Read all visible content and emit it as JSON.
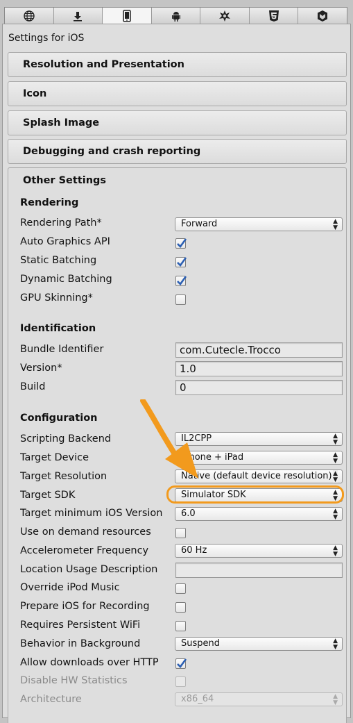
{
  "platform_tabs": [
    {
      "icon": "globe-icon",
      "active": false
    },
    {
      "icon": "download-icon",
      "active": false
    },
    {
      "icon": "mobile-device-icon",
      "active": true
    },
    {
      "icon": "android-icon",
      "active": false
    },
    {
      "icon": "blackberry-icon",
      "active": false
    },
    {
      "icon": "html5-icon",
      "active": false
    },
    {
      "icon": "tizen-icon",
      "active": false
    }
  ],
  "header": {
    "title": "Settings for iOS"
  },
  "sections": {
    "resolution": "Resolution and Presentation",
    "icon": "Icon",
    "splash": "Splash Image",
    "debugging": "Debugging and crash reporting",
    "other": "Other Settings"
  },
  "rendering": {
    "heading": "Rendering",
    "rendering_path": {
      "label": "Rendering Path*",
      "value": "Forward"
    },
    "auto_graphics_api": {
      "label": "Auto Graphics API",
      "checked": true
    },
    "static_batching": {
      "label": "Static Batching",
      "checked": true
    },
    "dynamic_batching": {
      "label": "Dynamic Batching",
      "checked": true
    },
    "gpu_skinning": {
      "label": "GPU Skinning*",
      "checked": false
    }
  },
  "identification": {
    "heading": "Identification",
    "bundle_identifier": {
      "label": "Bundle Identifier",
      "value": "com.Cutecle.Trocco"
    },
    "version": {
      "label": "Version*",
      "value": "1.0"
    },
    "build": {
      "label": "Build",
      "value": "0"
    }
  },
  "configuration": {
    "heading": "Configuration",
    "scripting_backend": {
      "label": "Scripting Backend",
      "value": "IL2CPP"
    },
    "target_device": {
      "label": "Target Device",
      "value": "iPhone + iPad"
    },
    "target_resolution": {
      "label": "Target Resolution",
      "value": "Native (default device resolution)"
    },
    "target_sdk": {
      "label": "Target SDK",
      "value": "Simulator SDK"
    },
    "target_min_ios": {
      "label": "Target minimum iOS Version",
      "value": "6.0"
    },
    "on_demand_resources": {
      "label": "Use on demand resources",
      "checked": false
    },
    "accelerometer_frequency": {
      "label": "Accelerometer Frequency",
      "value": "60 Hz"
    },
    "location_usage": {
      "label": "Location Usage Description",
      "value": ""
    },
    "override_ipod_music": {
      "label": "Override iPod Music",
      "checked": false
    },
    "prepare_ios_recording": {
      "label": "Prepare iOS for Recording",
      "checked": false
    },
    "persistent_wifi": {
      "label": "Requires Persistent WiFi",
      "checked": false
    },
    "behavior_background": {
      "label": "Behavior in Background",
      "value": "Suspend"
    },
    "allow_http": {
      "label": "Allow downloads over HTTP",
      "checked": true
    },
    "disable_hw_stats": {
      "label": "Disable HW Statistics",
      "checked": false
    },
    "architecture": {
      "label": "Architecture",
      "value": "x86_64"
    }
  },
  "annotation": {
    "arrow_color": "#f29a1d",
    "highlight_target": "Target SDK"
  }
}
